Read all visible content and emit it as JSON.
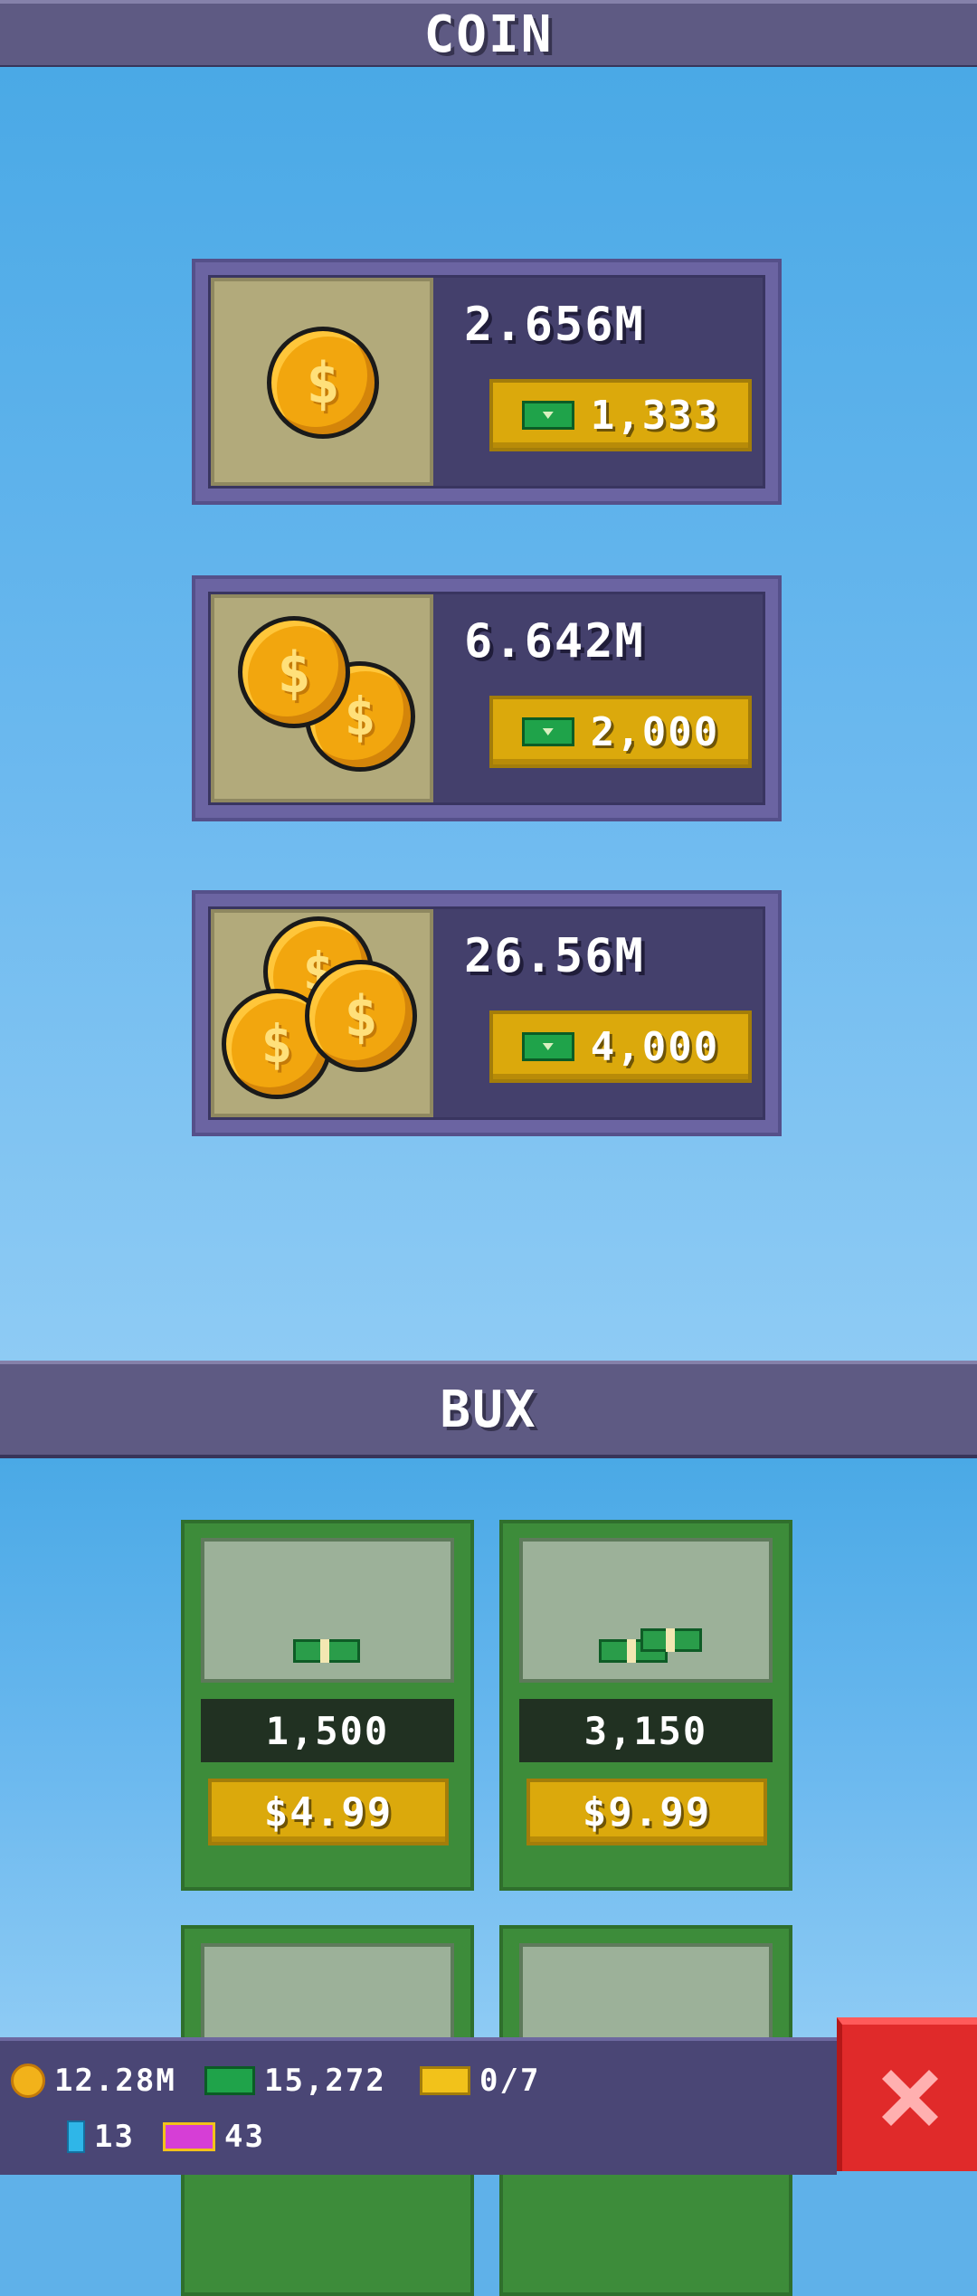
{
  "coin_section": {
    "title": "COIN",
    "offers": [
      {
        "amount": "2.656M",
        "price": "1,333",
        "coin_count": 1
      },
      {
        "amount": "6.642M",
        "price": "2,000",
        "coin_count": 2
      },
      {
        "amount": "26.56M",
        "price": "4,000",
        "coin_count": 3
      }
    ]
  },
  "bux_section": {
    "title": "BUX",
    "packs": [
      {
        "quantity": "1,500",
        "price": "$4.99"
      },
      {
        "quantity": "3,150",
        "price": "$9.99"
      }
    ]
  },
  "status": {
    "coins": "12.28M",
    "bux": "15,272",
    "tickets": "0/7",
    "gems": "13",
    "vip_tickets": "43"
  },
  "icons": {
    "coin": "coin-icon",
    "bux": "bux-bill-icon",
    "ticket": "golden-ticket-icon",
    "gem": "blue-gem-icon",
    "vip": "vip-ticket-icon",
    "close": "close-x-icon"
  },
  "colors": {
    "header_bar": "#5e5a83",
    "coin_card": "#6b64a2",
    "price_button": "#dba90c",
    "bux_card": "#3d8c3a",
    "close_button": "#e02a2a"
  }
}
